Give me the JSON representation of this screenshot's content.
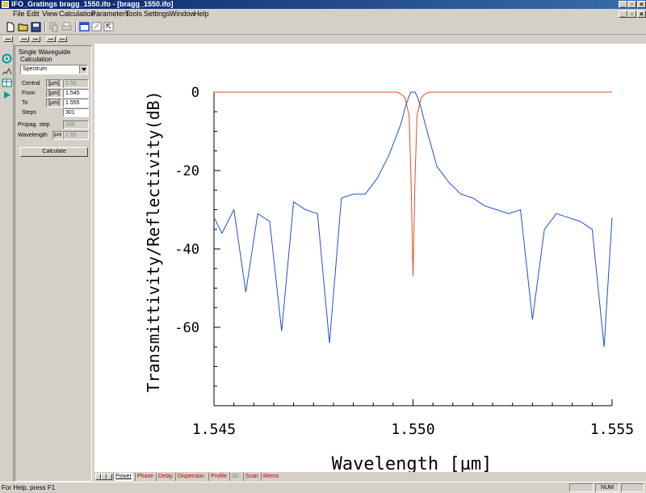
{
  "window": {
    "title": "IFO_Gratings bragg_1550.ifo - [bragg_1550.ifo]",
    "controls": {
      "minimize": "_",
      "restore": "▫",
      "close": "×"
    }
  },
  "menu": [
    "File",
    "Edit",
    "View",
    "Calculation",
    "Parameters",
    "Tools",
    "Settings",
    "Window",
    "Help"
  ],
  "panel": {
    "section_title": "Single Waveguide",
    "calculation_label": "Calculation",
    "calculation_value": "Spectrum",
    "central": {
      "label": "Central",
      "unit": "[µm]",
      "value": "1.55"
    },
    "from": {
      "label": "From",
      "unit": "[µm]",
      "value": "1.545"
    },
    "to": {
      "label": "To",
      "unit": "[µm]",
      "value": "1.555"
    },
    "steps": {
      "label": "Steps",
      "value": "301"
    },
    "propag_step": {
      "label": "Propag. step",
      "value": "100"
    },
    "wavelength": {
      "label": "Wavelength",
      "unit": "[µm]",
      "value": "1.55"
    },
    "calculate_button": "Calculate"
  },
  "tabs": [
    "Power",
    "Phase",
    "Delay",
    "Dispersion",
    "Profile",
    "3D",
    "Scan",
    "Memo"
  ],
  "active_tab": "Power",
  "status": {
    "help_text": "For Help, press F1",
    "num_indicator": "NUM"
  },
  "colors": {
    "reflectivity": "#e05020",
    "transmittivity": "#2050d0",
    "title_bar": "#0a246a"
  },
  "chart_data": {
    "type": "line",
    "xlabel": "Wavelength [µm]",
    "ylabel": "Transmittivity/Reflectivity(dB)",
    "xlim": [
      1.545,
      1.555
    ],
    "ylim": [
      -80,
      0
    ],
    "x_ticks": [
      "1.545",
      "1.550",
      "1.555"
    ],
    "y_ticks": [
      "0",
      "-20",
      "-40",
      "-60"
    ],
    "y_tick_values": [
      0,
      -20,
      -40,
      -60
    ],
    "series": [
      {
        "color": "#e05020",
        "x": [
          1.545,
          1.5496,
          1.5497,
          1.5498,
          1.5499,
          1.54995,
          1.55,
          1.55005,
          1.5501,
          1.5502,
          1.5503,
          1.5504,
          1.555
        ],
        "y": [
          0,
          0,
          -0.5,
          -1.5,
          -6,
          -22,
          -47,
          -22,
          -6,
          -1.5,
          -0.5,
          0,
          0
        ]
      },
      {
        "color": "#2050d0",
        "x": [
          1.545,
          1.5452,
          1.5455,
          1.5458,
          1.5461,
          1.5464,
          1.5467,
          1.547,
          1.5473,
          1.5476,
          1.5479,
          1.5482,
          1.5485,
          1.5488,
          1.5491,
          1.5494,
          1.5497,
          1.5498,
          1.5499,
          1.54995,
          1.55,
          1.55005,
          1.5501,
          1.5502,
          1.5503,
          1.5506,
          1.5509,
          1.5512,
          1.5515,
          1.5518,
          1.5521,
          1.5524,
          1.5527,
          1.553,
          1.5533,
          1.5536,
          1.5539,
          1.5542,
          1.5545,
          1.5548,
          1.555
        ],
        "y": [
          -32,
          -36,
          -30,
          -51,
          -31,
          -33,
          -61,
          -28,
          -30,
          -31,
          -64,
          -27,
          -26,
          -26,
          -22,
          -16,
          -8,
          -4,
          -1,
          0,
          0,
          0,
          -1,
          -4,
          -8,
          -19,
          -23,
          -26,
          -27,
          -29,
          -30,
          -31,
          -30,
          -58,
          -35,
          -31,
          -32,
          -33,
          -35,
          -65,
          -32
        ]
      }
    ]
  }
}
